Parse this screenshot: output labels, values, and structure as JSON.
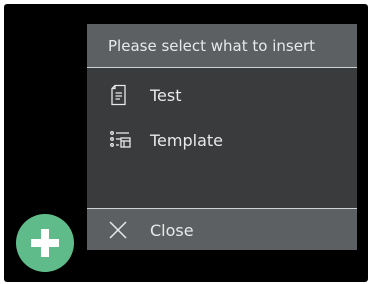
{
  "menu": {
    "title": "Please select what to insert",
    "items": [
      {
        "label": "Test",
        "icon": "document-icon"
      },
      {
        "label": "Template",
        "icon": "template-list-icon"
      }
    ],
    "close": {
      "label": "Close",
      "icon": "close-icon"
    }
  },
  "fab": {
    "icon": "plus-icon"
  },
  "colors": {
    "background": "#000000",
    "menu_body": "#393b3c",
    "menu_header": "#5d6062",
    "text": "#e8e9ea",
    "fab": "#5fbc8a"
  }
}
